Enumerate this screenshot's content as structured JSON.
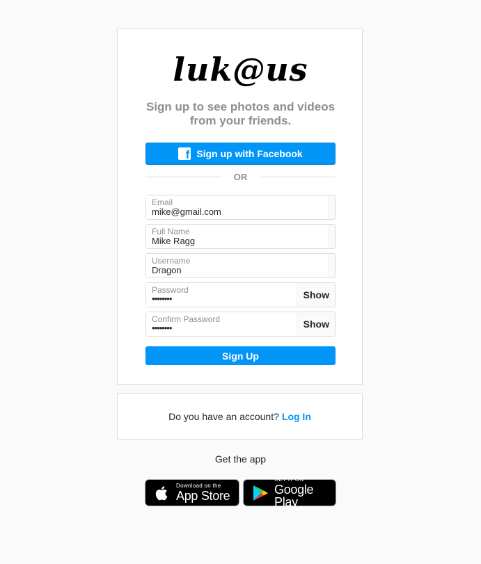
{
  "brand": {
    "logo_text": "luk@us"
  },
  "signup": {
    "tagline": "Sign up to see photos and videos from your friends.",
    "facebook_button": "Sign up with Facebook",
    "or_divider": "OR",
    "fields": {
      "email": {
        "label": "Email",
        "value": "mike@gmail.com"
      },
      "full_name": {
        "label": "Full Name",
        "value": "Mike Ragg"
      },
      "username": {
        "label": "Username",
        "value": "Dragon"
      },
      "password": {
        "label": "Password",
        "value": "••••••••",
        "toggle": "Show"
      },
      "confirm_password": {
        "label": "Confirm Password",
        "value": "••••••••",
        "toggle": "Show"
      }
    },
    "submit_button": "Sign Up"
  },
  "login_prompt": {
    "text": "Do you have an account?",
    "link": "Log In"
  },
  "get_app": {
    "label": "Get the app",
    "app_store": {
      "small": "Download on the",
      "big": "App Store",
      "icon": "apple-icon"
    },
    "google_play": {
      "small": "GET IT ON",
      "big": "Google Play",
      "icon": "google-play-icon"
    }
  },
  "colors": {
    "accent": "#0095f6",
    "background": "#fafafa",
    "border": "#dbdbdb",
    "muted_text": "#8e8e8e"
  }
}
